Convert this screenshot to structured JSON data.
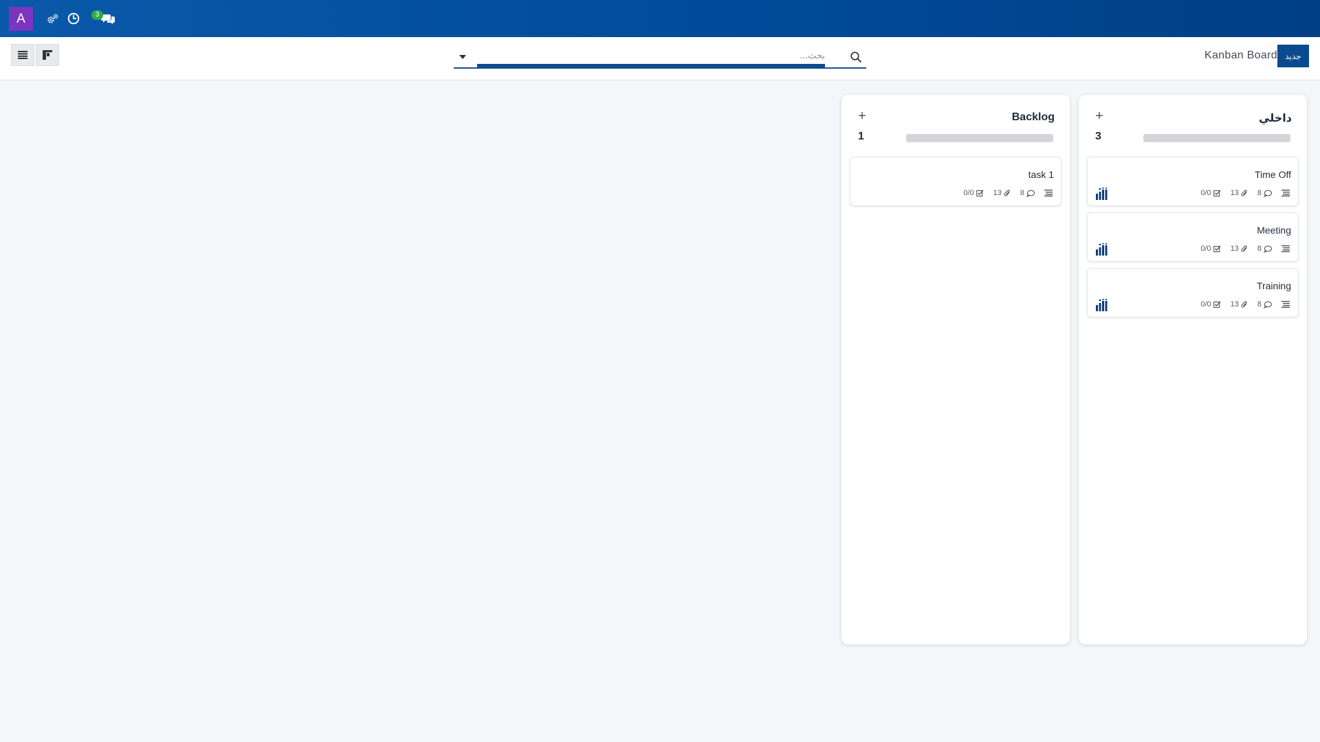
{
  "navbar": {
    "user_initial": "A",
    "chat_badge": "3",
    "colors": {
      "bar": "#004a98",
      "avatar": "#7b35c1",
      "badge": "#2eaa4a"
    },
    "icons": [
      "settings-cogs-icon",
      "clock-icon",
      "chat-icon"
    ]
  },
  "control_panel": {
    "new_button": "جديد",
    "breadcrumb": "Kanban Board",
    "search_placeholder": "بحث...",
    "view_buttons": [
      "list-view-icon",
      "kanban-view-icon"
    ]
  },
  "columns": [
    {
      "title": "داخلي",
      "count": "3",
      "progress": 0,
      "cards": [
        {
          "title": "Time Off",
          "checklist": "0/0",
          "attachments": "13",
          "comments": "8"
        },
        {
          "title": "Meeting",
          "checklist": "0/0",
          "attachments": "13",
          "comments": "8"
        },
        {
          "title": "Training",
          "checklist": "0/0",
          "attachments": "13",
          "comments": "8"
        }
      ]
    },
    {
      "title": "Backlog",
      "count": "1",
      "progress": 0,
      "cards": [
        {
          "title": "task 1",
          "checklist": "0/0",
          "attachments": "13",
          "comments": "8"
        }
      ]
    }
  ]
}
